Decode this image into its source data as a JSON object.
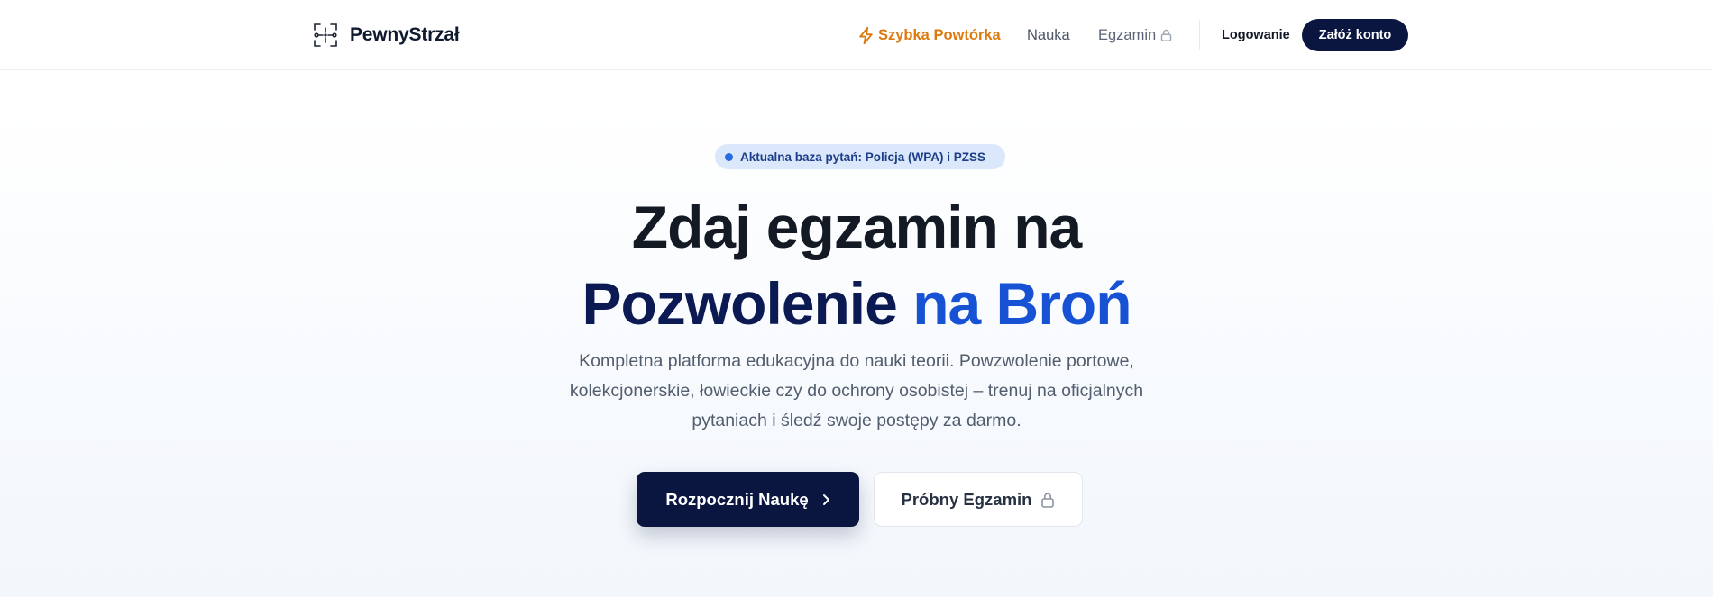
{
  "brand": {
    "name": "PewnyStrzał",
    "logo_icon": "crosshair-icon"
  },
  "nav": {
    "quick_review": {
      "label": "Szybka Powtórka",
      "icon": "lightning-icon",
      "color": "#db7a0e"
    },
    "learn": {
      "label": "Nauka"
    },
    "exam": {
      "label": "Egzamin",
      "icon": "lock-icon"
    },
    "login": {
      "label": "Logowanie"
    },
    "register": {
      "label": "Załóż konto"
    }
  },
  "hero": {
    "badge": "Aktualna baza pytań: Policja (WPA) i PZSS",
    "title_line1": "Zdaj egzamin na",
    "title_line2_part1": "Pozwolenie",
    "title_line2_part2": "na Broń",
    "description": "Kompletna platforma edukacyjna do nauki teorii. Powzwolenie portowe, kolekcjonerskie, łowieckie czy do ochrony osobistej – trenuj na oficjalnych pytaniach i śledź swoje postępy za darmo.",
    "primary_button": {
      "label": "Rozpocznij Naukę",
      "icon": "chevron-right-icon"
    },
    "secondary_button": {
      "label": "Próbny Egzamin",
      "icon": "lock-icon"
    }
  },
  "colors": {
    "navy": "#0b1640",
    "accent_blue": "#1751d4",
    "accent_orange": "#db7a0e",
    "badge_bg": "#dbe8fb"
  }
}
